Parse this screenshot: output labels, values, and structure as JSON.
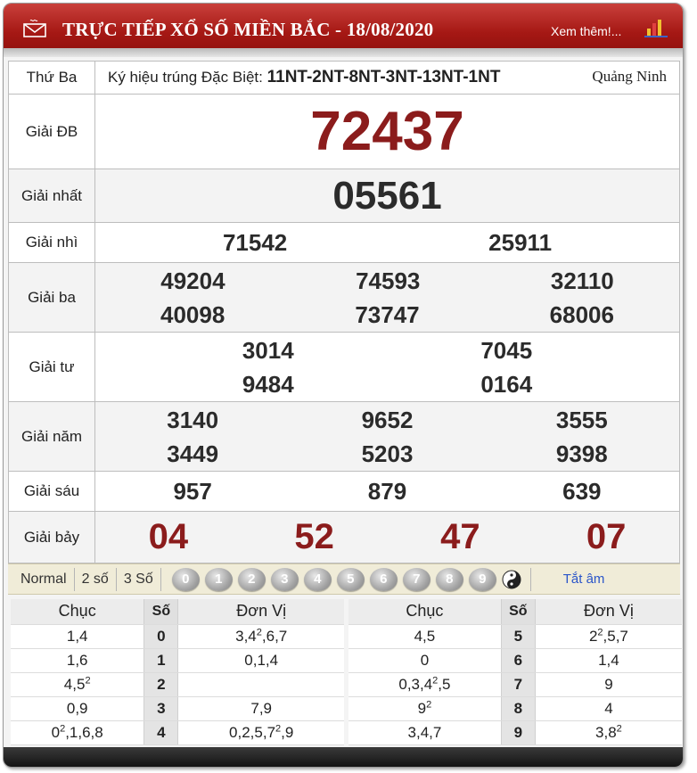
{
  "header": {
    "title": "TRỰC TIẾP XỔ SỐ MIỀN BẮC - 18/08/2020",
    "more_link": "Xem thêm!...",
    "icons": {
      "mail": "mail-icon",
      "chart": "bar-chart-icon"
    },
    "colors": {
      "header_red": "#a51814",
      "prize_red": "#8b1c1c",
      "link_blue": "#2a55c9"
    }
  },
  "info": {
    "day": "Thứ Ba",
    "kyhieu_label": "Ký hiệu trúng Đặc Biệt:",
    "kyhieu_value": "11NT-2NT-8NT-3NT-13NT-1NT",
    "province": "Quảng Ninh"
  },
  "prizes": {
    "db": {
      "label": "Giải ĐB",
      "numbers": [
        "72437"
      ]
    },
    "g1": {
      "label": "Giải nhất",
      "numbers": [
        "05561"
      ]
    },
    "g2": {
      "label": "Giải nhì",
      "numbers": [
        "71542",
        "25911"
      ]
    },
    "g3": {
      "label": "Giải ba",
      "numbers": [
        "49204",
        "74593",
        "32110",
        "40098",
        "73747",
        "68006"
      ]
    },
    "g4": {
      "label": "Giải tư",
      "numbers": [
        "3014",
        "7045",
        "9484",
        "0164"
      ]
    },
    "g5": {
      "label": "Giải năm",
      "numbers": [
        "3140",
        "9652",
        "3555",
        "3449",
        "5203",
        "9398"
      ]
    },
    "g6": {
      "label": "Giải sáu",
      "numbers": [
        "957",
        "879",
        "639"
      ]
    },
    "g7": {
      "label": "Giải bảy",
      "numbers": [
        "04",
        "52",
        "47",
        "07"
      ]
    }
  },
  "toolbar": {
    "normal": "Normal",
    "two": "2 số",
    "three": "3 Số",
    "balls": [
      "0",
      "1",
      "2",
      "3",
      "4",
      "5",
      "6",
      "7",
      "8",
      "9"
    ],
    "yin_yang": "yin-yang-icon",
    "tat_am": "Tắt âm"
  },
  "loto": {
    "headers": {
      "chuc": "Chục",
      "so": "Số",
      "donvi": "Đơn Vị"
    },
    "left": [
      {
        "chuc": "1,4",
        "so": "0",
        "donvi": "3,4²,6,7"
      },
      {
        "chuc": "1,6",
        "so": "1",
        "donvi": "0,1,4"
      },
      {
        "chuc": "4,5²",
        "so": "2",
        "donvi": ""
      },
      {
        "chuc": "0,9",
        "so": "3",
        "donvi": "7,9"
      },
      {
        "chuc": "0²,1,6,8",
        "so": "4",
        "donvi": "0,2,5,7²,9"
      }
    ],
    "right": [
      {
        "chuc": "4,5",
        "so": "5",
        "donvi": "2²,5,7"
      },
      {
        "chuc": "0",
        "so": "6",
        "donvi": "1,4"
      },
      {
        "chuc": "0,3,4²,5",
        "so": "7",
        "donvi": "9"
      },
      {
        "chuc": "9²",
        "so": "8",
        "donvi": "4"
      },
      {
        "chuc": "3,4,7",
        "so": "9",
        "donvi": "3,8²"
      }
    ]
  }
}
